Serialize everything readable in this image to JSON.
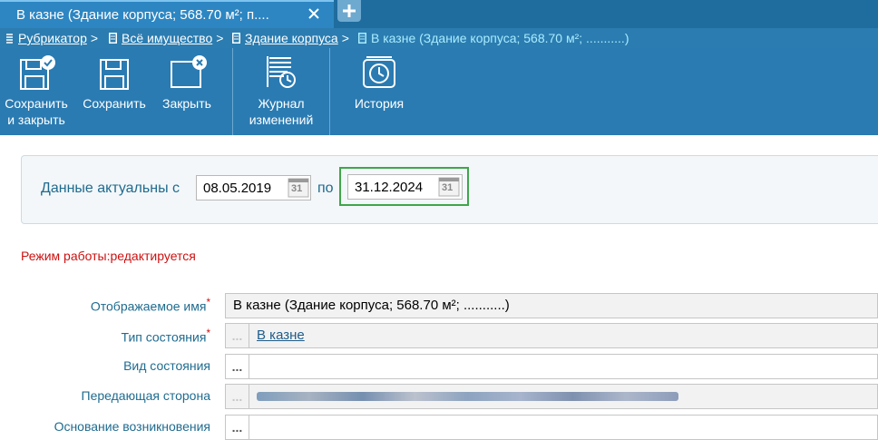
{
  "tab": {
    "title": "В казне (Здание корпуса; 568.70 м²; п....",
    "close_label": "✕",
    "add_label": "+"
  },
  "breadcrumb": {
    "items": [
      "Рубрикатор",
      "Всё имущество",
      "Здание корпуса"
    ],
    "separator": ">",
    "current": "В казне (Здание корпуса; 568.70 м²; ...........)"
  },
  "toolbar": {
    "save_close": [
      "Сохранить",
      "и закрыть"
    ],
    "save": "Сохранить",
    "close": "Закрыть",
    "journal": [
      "Журнал",
      "изменений"
    ],
    "history": "История"
  },
  "date_range": {
    "label": "Данные актуальны с",
    "from": "08.05.2019",
    "to_label": "по",
    "to": "31.12.2024",
    "calendar_day": "31"
  },
  "mode": "Режим работы:редактируется",
  "form": {
    "display_name": {
      "label": "Отображаемое имя",
      "required": "*",
      "value": "В казне (Здание корпуса; 568.70 м²; ...........)"
    },
    "state_type": {
      "label": "Тип состояния",
      "required": "*",
      "value": "В казне",
      "button": "..."
    },
    "state_kind": {
      "label": "Вид состояния",
      "value": "",
      "button": "..."
    },
    "transferring_party": {
      "label": "Передающая сторона",
      "button": "..."
    },
    "origin_basis": {
      "label": "Основание возникновения",
      "value": "",
      "button": "..."
    }
  },
  "colors": {
    "accent": "#2a7bb2",
    "tabbar": "#1f6c9e",
    "label": "#1f6b8f",
    "required": "#cc1111",
    "highlight": "#3fa64a"
  }
}
